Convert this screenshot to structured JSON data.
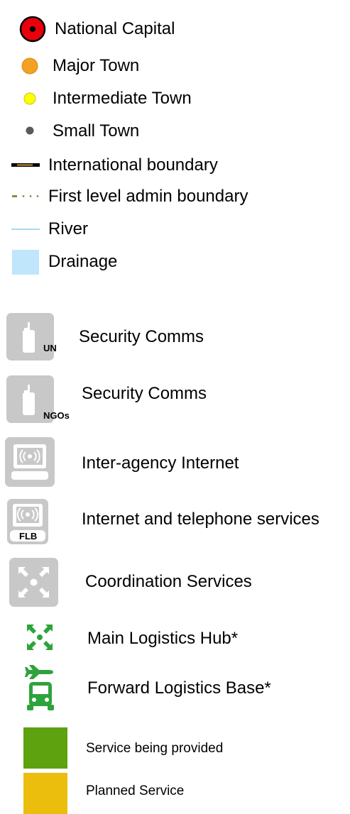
{
  "legend": {
    "items": [
      {
        "label": "National Capital"
      },
      {
        "label": "Major Town"
      },
      {
        "label": "Intermediate Town"
      },
      {
        "label": "Small Town"
      },
      {
        "label": "International boundary"
      },
      {
        "label": "First level admin boundary"
      },
      {
        "label": "River"
      },
      {
        "label": "Drainage"
      }
    ],
    "services": [
      {
        "label": "Security Comms",
        "tag": "UN",
        "icon": "radio-handset-icon"
      },
      {
        "label": "Security Comms",
        "tag": "NGOs",
        "icon": "radio-handset-icon"
      },
      {
        "label": "Inter-agency Internet",
        "icon": "computer-terminal-icon"
      },
      {
        "label": "Internet and telephone services",
        "tag": "FLB",
        "icon": "signal-terminal-icon"
      },
      {
        "label": "Coordination Services",
        "icon": "coordination-arrows-icon"
      },
      {
        "label": "Main Logistics Hub*",
        "icon": "logistics-hub-icon"
      },
      {
        "label": "Forward Logistics Base*",
        "icon": "truck-plane-icon"
      }
    ],
    "status": [
      {
        "label": "Service being provided",
        "color": "#5ea20f"
      },
      {
        "label": "Planned Service",
        "color": "#ebbd0c"
      }
    ]
  },
  "colors": {
    "capital_fill": "#e8000d",
    "major_town": "#f4a024",
    "intermediate_town": "#ffff00",
    "small_town": "#5a5a5a",
    "river": "#a8d8f0",
    "drainage": "#bfe6fb",
    "icon_grey": "#c8c8c8",
    "logistics_green": "#2fa33b"
  }
}
